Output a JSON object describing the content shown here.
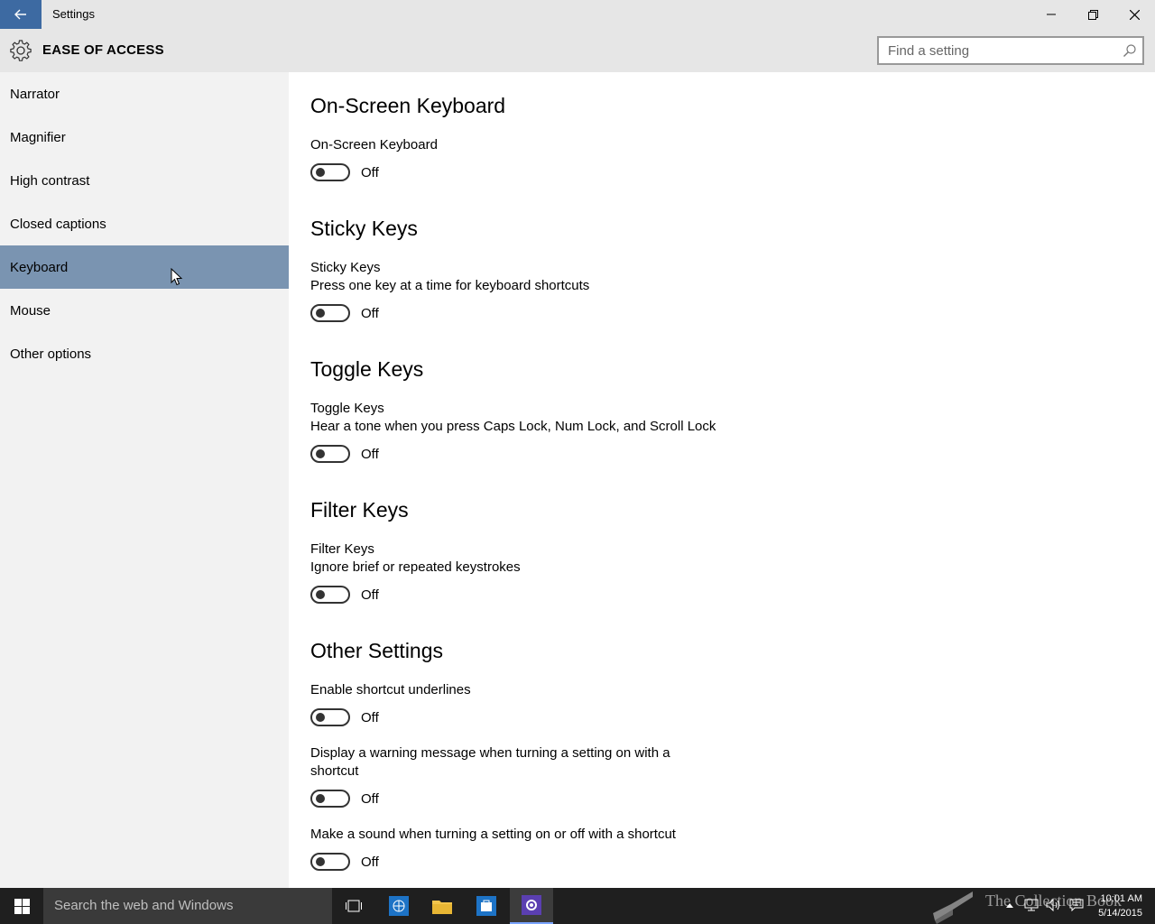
{
  "window": {
    "title": "Settings"
  },
  "header": {
    "title": "EASE OF ACCESS",
    "search_placeholder": "Find a setting"
  },
  "sidebar": {
    "items": [
      {
        "label": "Narrator",
        "active": false
      },
      {
        "label": "Magnifier",
        "active": false
      },
      {
        "label": "High contrast",
        "active": false
      },
      {
        "label": "Closed captions",
        "active": false
      },
      {
        "label": "Keyboard",
        "active": true
      },
      {
        "label": "Mouse",
        "active": false
      },
      {
        "label": "Other options",
        "active": false
      }
    ]
  },
  "main": {
    "on_screen": {
      "title": "On-Screen Keyboard",
      "label": "On-Screen Keyboard",
      "state": "Off"
    },
    "sticky": {
      "title": "Sticky Keys",
      "label": "Sticky Keys",
      "description": "Press one key at a time for keyboard shortcuts",
      "state": "Off"
    },
    "toggle": {
      "title": "Toggle Keys",
      "label": "Toggle Keys",
      "description": "Hear a tone when you press Caps Lock, Num Lock, and Scroll Lock",
      "state": "Off"
    },
    "filter": {
      "title": "Filter Keys",
      "label": "Filter Keys",
      "description": "Ignore brief or repeated keystrokes",
      "state": "Off"
    },
    "other": {
      "title": "Other Settings",
      "underlines": {
        "label": "Enable shortcut underlines",
        "state": "Off"
      },
      "warning": {
        "label_line1": "Display a warning message when turning a setting on with a",
        "label_line2": "shortcut",
        "state": "Off"
      },
      "sound": {
        "label": "Make a sound when turning a setting on or off with a shortcut",
        "state": "Off"
      }
    }
  },
  "taskbar": {
    "search_text": "Search the web and Windows",
    "watermark": "The Collection Book",
    "time": "10:01 AM",
    "date": "5/14/2015"
  },
  "colors": {
    "accent": "#3d6aa2",
    "active_nav": "#7a94b1",
    "taskbar": "#1f1f1f",
    "chrome": "#e6e6e6"
  }
}
